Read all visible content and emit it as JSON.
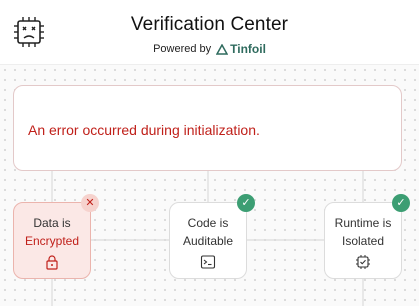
{
  "header": {
    "title": "Verification Center",
    "powered_by": "Powered by",
    "brand": "Tinfoil",
    "logo_icon": "chip-sad-face-icon"
  },
  "error": {
    "message": "An error occurred during initialization."
  },
  "nodes": [
    {
      "line1": "Data is",
      "line2": "Encrypted",
      "status": "failed",
      "icon": "lock-icon"
    },
    {
      "line1": "Code is",
      "line2": "Auditable",
      "status": "verified",
      "icon": "terminal-icon"
    },
    {
      "line1": "Runtime is",
      "line2": "Isolated",
      "status": "verified",
      "icon": "cpu-check-icon"
    }
  ],
  "badges": {
    "ok": "✓",
    "fail": "✕"
  },
  "colors": {
    "error": "#c0201a",
    "success": "#3c9e73",
    "brand": "#2f6b5e"
  }
}
